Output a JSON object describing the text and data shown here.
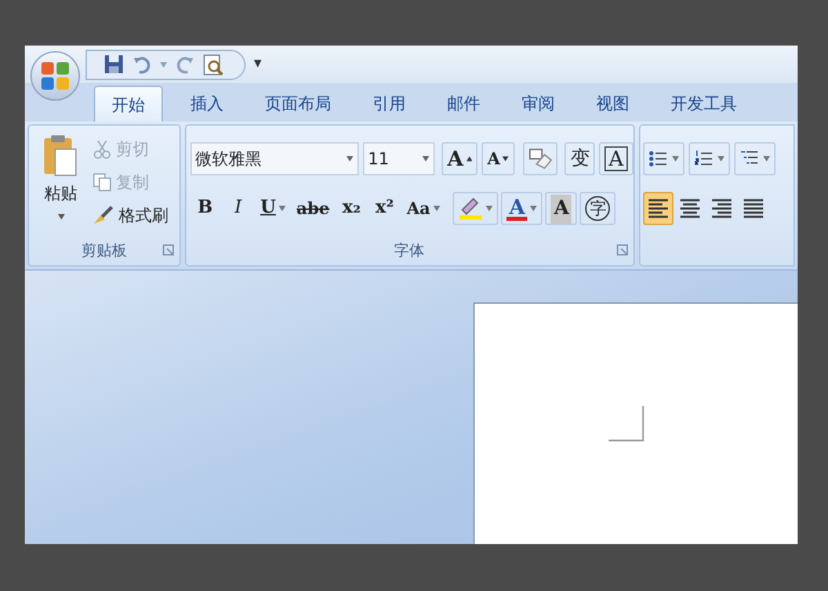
{
  "quick_access": {
    "customize": "▾"
  },
  "tabs": [
    {
      "label": "开始",
      "selected": true
    },
    {
      "label": "插入",
      "selected": false
    },
    {
      "label": "页面布局",
      "selected": false
    },
    {
      "label": "引用",
      "selected": false
    },
    {
      "label": "邮件",
      "selected": false
    },
    {
      "label": "审阅",
      "selected": false
    },
    {
      "label": "视图",
      "selected": false
    },
    {
      "label": "开发工具",
      "selected": false
    }
  ],
  "clipboard": {
    "paste": "粘贴",
    "label": "剪贴板",
    "items": [
      {
        "kind": "cut",
        "label": "剪切",
        "disabled": true
      },
      {
        "kind": "copy",
        "label": "复制",
        "disabled": true
      },
      {
        "kind": "painter",
        "label": "格式刷",
        "disabled": false
      }
    ]
  },
  "font": {
    "name": "微软雅黑",
    "size": "11",
    "label": "字体",
    "row1": [
      {
        "kind": "grow",
        "text": "A"
      },
      {
        "kind": "shrink",
        "text": "A"
      },
      {
        "kind": "clear"
      },
      {
        "kind": "phonetic",
        "text": "变"
      },
      {
        "kind": "border",
        "text": "A"
      }
    ],
    "row2": [
      {
        "kind": "bold",
        "text": "B"
      },
      {
        "kind": "italic",
        "text": "I"
      },
      {
        "kind": "underline",
        "text": "U"
      },
      {
        "kind": "strike",
        "text": "abe"
      },
      {
        "kind": "sub",
        "text": "x₂"
      },
      {
        "kind": "sup",
        "text": "x²"
      },
      {
        "kind": "case",
        "text": "Aa"
      },
      {
        "kind": "highlight"
      },
      {
        "kind": "color",
        "text": "A"
      },
      {
        "kind": "shading",
        "text": "A"
      },
      {
        "kind": "enclose",
        "text": "字"
      }
    ]
  },
  "paragraph": {
    "lists": [
      {
        "kind": "bullets"
      },
      {
        "kind": "numbering"
      },
      {
        "kind": "multilevel"
      }
    ],
    "align": [
      {
        "kind": "left",
        "selected": true
      },
      {
        "kind": "center",
        "selected": false
      },
      {
        "kind": "right",
        "selected": false
      },
      {
        "kind": "justify",
        "selected": false
      }
    ]
  }
}
